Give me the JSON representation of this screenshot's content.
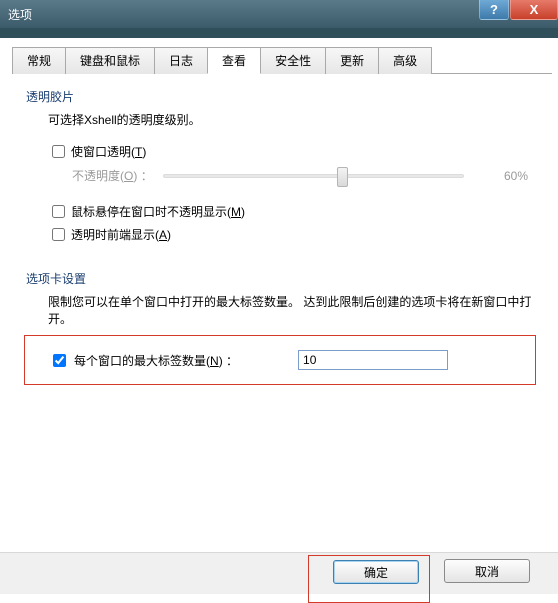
{
  "window": {
    "title": "选项",
    "help": "?",
    "close": "X"
  },
  "tabs": {
    "general": "常规",
    "keyboard_mouse": "键盘和鼠标",
    "log": "日志",
    "view": "查看",
    "security": "安全性",
    "update": "更新",
    "advanced": "高级"
  },
  "transparency": {
    "title": "透明胶片",
    "desc": "可选择Xshell的透明度级别。",
    "make_transparent_label": "使窗口透明",
    "make_transparent_accel": "T",
    "opacity_label": "不透明度",
    "opacity_accel": "O",
    "opacity_sep": " ：",
    "opacity_value": "60%",
    "hover_opaque_label": "鼠标悬停在窗口时不透明显示",
    "hover_opaque_accel": "M",
    "always_on_top_label": "透明时前端显示",
    "always_on_top_accel": "A"
  },
  "tabsetting": {
    "title": "选项卡设置",
    "desc": "限制您可以在单个窗口中打开的最大标签数量。 达到此限制后创建的选项卡将在新窗口中打开。",
    "maxtab_label": "每个窗口的最大标签数量",
    "maxtab_accel": "N",
    "maxtab_sep": " ：",
    "maxtab_value": "10"
  },
  "footer": {
    "ok": "确定",
    "cancel": "取消"
  }
}
